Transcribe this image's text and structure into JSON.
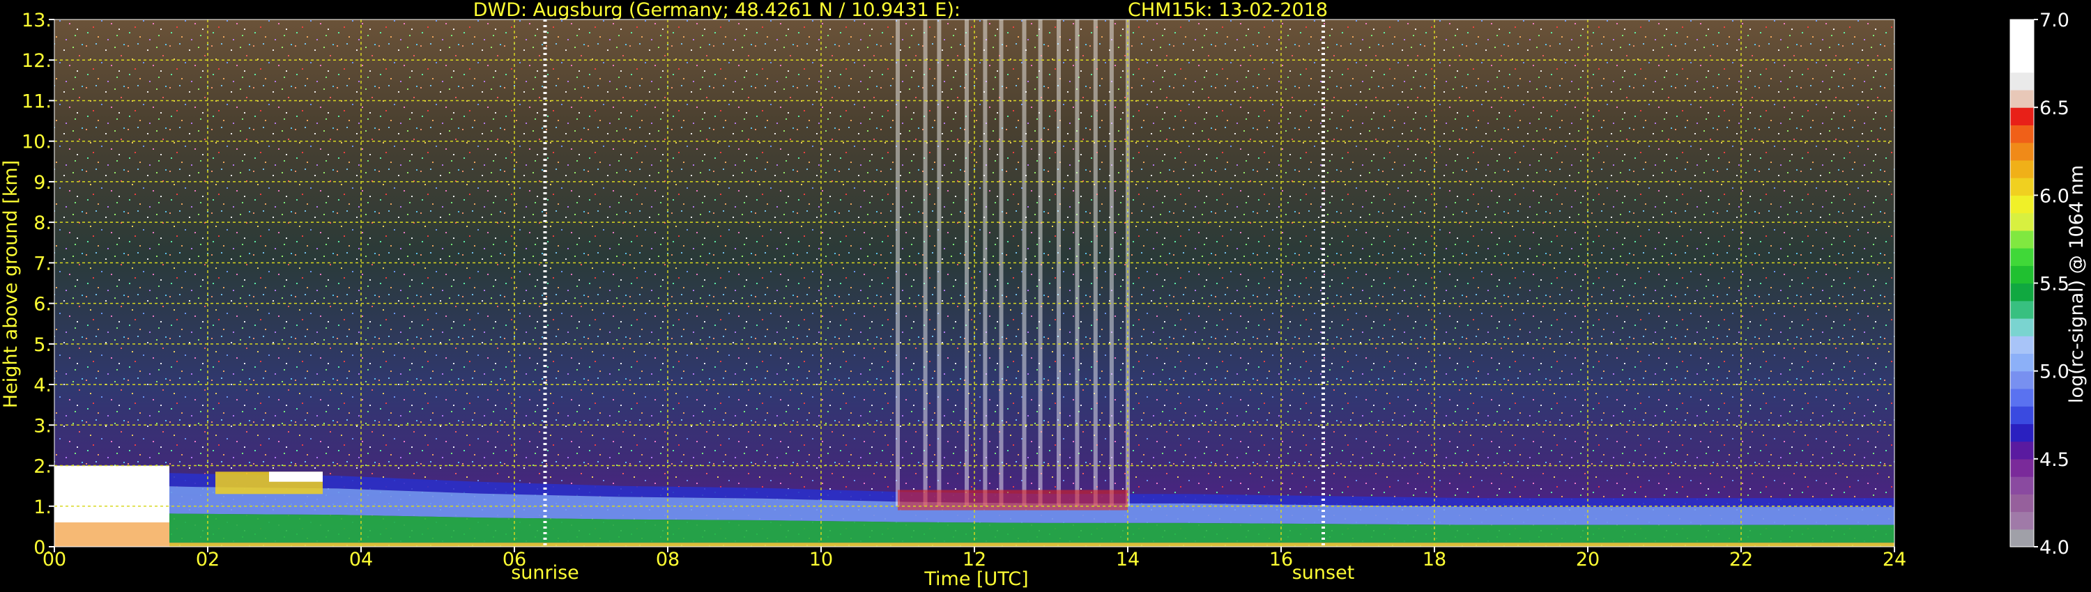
{
  "title": {
    "station": "DWD: Augsburg (Germany; 48.4261 N / 10.9431 E):",
    "instrument_date": "CHM15k: 13-02-2018"
  },
  "chart_data": {
    "type": "heatmap",
    "xlabel": "Time [UTC]",
    "ylabel": "Height above ground [km]",
    "xlim": [
      0,
      24
    ],
    "ylim": [
      0,
      13
    ],
    "x_ticks": [
      "00",
      "02",
      "04",
      "06",
      "08",
      "10",
      "12",
      "14",
      "16",
      "18",
      "20",
      "22",
      "24"
    ],
    "y_ticks": [
      "0.",
      "1.",
      "2.",
      "3.",
      "4.",
      "5.",
      "6.",
      "7.",
      "8.",
      "9.",
      "10.",
      "11.",
      "12.",
      "13."
    ],
    "grid": true,
    "colorbar": {
      "label": "log(rc-signal) @ 1064 nm",
      "range": [
        4.0,
        7.0
      ],
      "ticks": [
        "4.0",
        "4.5",
        "5.0",
        "5.5",
        "6.0",
        "6.5",
        "7.0"
      ],
      "colors": [
        "#a0a0a8",
        "#a07aa8",
        "#96609c",
        "#8a4aa0",
        "#7a2a9a",
        "#5a1aa0",
        "#2a20c0",
        "#3a4ae0",
        "#5a72f0",
        "#7890f0",
        "#8cb0f8",
        "#a8c4f8",
        "#7ad4d0",
        "#38c080",
        "#10a840",
        "#20c030",
        "#40d838",
        "#80e840",
        "#d8f040",
        "#f0f028",
        "#f0d020",
        "#f0b018",
        "#f08a18",
        "#f06018",
        "#e82018",
        "#e8c8b8",
        "#eaeaea",
        "#ffffff",
        "#ffffff",
        "#ffffff"
      ]
    },
    "markers": [
      {
        "label": "sunrise",
        "time": 6.4
      },
      {
        "label": "sunset",
        "time": 16.55
      }
    ],
    "layers": [
      {
        "name": "boundary layer",
        "top_km": [
          1.9,
          1.8,
          1.75,
          1.6,
          1.5,
          1.45,
          1.35,
          1.3,
          1.3,
          1.25,
          1.2,
          1.2,
          1.2,
          1.2
        ]
      },
      {
        "name": "cloud",
        "start": 0.0,
        "end": 1.5,
        "base_km": 0.0,
        "top_km": 2.0
      },
      {
        "name": "cloud",
        "start": 2.1,
        "end": 3.5,
        "base_km": 1.3,
        "top_km": 1.85
      },
      {
        "name": "precipitation streaks",
        "start": 11.0,
        "end": 14.0,
        "base_km": 1.0,
        "top_km": 13.0
      }
    ]
  }
}
